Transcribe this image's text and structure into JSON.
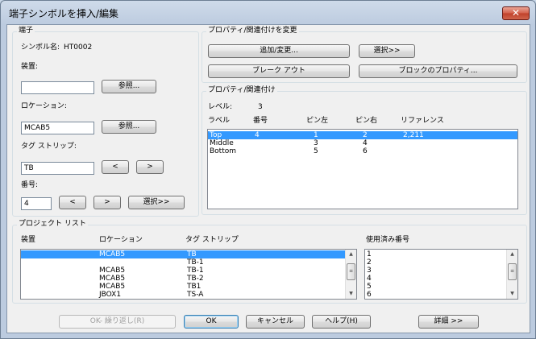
{
  "window": {
    "title": "端子シンボルを挿入/編集",
    "close_glyph": "✕"
  },
  "terminal": {
    "group_title": "端子",
    "symbol_name_label": "シンボル名:",
    "symbol_name_value": "HT0002",
    "device_label": "装置:",
    "device_value": "",
    "device_browse": "参照...",
    "location_label": "ロケーション:",
    "location_value": "MCAB5",
    "location_browse": "参照...",
    "strip_label": "タグ ストリップ:",
    "strip_value": "TB",
    "strip_prev": "<",
    "strip_next": ">",
    "number_label": "番号:",
    "number_value": "4",
    "number_prev": "<",
    "number_next": ">",
    "number_select": "選択>>"
  },
  "property_change": {
    "group_title": "プロパティ/関連付けを変更",
    "add_change": "追加/変更...",
    "select": "選択>>",
    "break_out": "ブレーク アウト",
    "block_props": "ブロックのプロパティ..."
  },
  "properties": {
    "group_title": "プロパティ/関連付け",
    "level_label": "レベル:",
    "level_value": "3",
    "columns": [
      "ラベル",
      "番号",
      "ピン左",
      "ピン右",
      "リファレンス"
    ],
    "rows": [
      {
        "label": "Top",
        "number": "4",
        "pin_left": "1",
        "pin_right": "2",
        "reference": "2,211",
        "selected": true
      },
      {
        "label": "Middle",
        "number": "",
        "pin_left": "3",
        "pin_right": "4",
        "reference": "",
        "selected": false
      },
      {
        "label": "Bottom",
        "number": "",
        "pin_left": "5",
        "pin_right": "6",
        "reference": "",
        "selected": false
      }
    ]
  },
  "project_list": {
    "group_title": "プロジェクト リスト",
    "columns": [
      "装置",
      "ロケーション",
      "タグ ストリップ"
    ],
    "used_numbers_label": "使用済み番号",
    "rows": [
      {
        "device": "",
        "location": "MCAB5",
        "strip": "TB",
        "selected": true
      },
      {
        "device": "",
        "location": "",
        "strip": "TB-1",
        "selected": false
      },
      {
        "device": "",
        "location": "MCAB5",
        "strip": "TB-1",
        "selected": false
      },
      {
        "device": "",
        "location": "MCAB5",
        "strip": "TB-2",
        "selected": false
      },
      {
        "device": "",
        "location": "MCAB5",
        "strip": "TB1",
        "selected": false
      },
      {
        "device": "",
        "location": "JBOX1",
        "strip": "TS-A",
        "selected": false
      }
    ],
    "used_numbers": [
      "1",
      "2",
      "3",
      "4",
      "5",
      "6"
    ]
  },
  "footer": {
    "ok_repeat": "OK- 繰り返し(R)",
    "ok": "OK",
    "cancel": "キャンセル",
    "help": "ヘルプ(H)",
    "details": "詳細 >>"
  },
  "scroll": {
    "up": "▲",
    "down": "▼",
    "grip": "≡"
  }
}
